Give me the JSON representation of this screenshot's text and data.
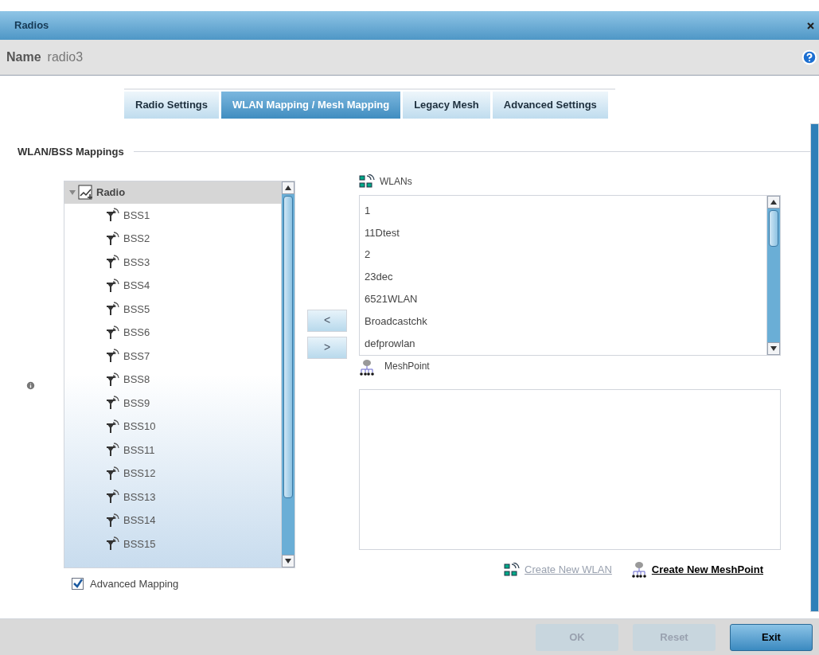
{
  "window": {
    "title": "Radios",
    "name_label": "Name",
    "name_value": "radio3"
  },
  "tabs": [
    {
      "label": "Radio Settings",
      "selected": false
    },
    {
      "label": "WLAN Mapping / Mesh Mapping",
      "selected": true
    },
    {
      "label": "Legacy Mesh",
      "selected": false
    },
    {
      "label": "Advanced Settings",
      "selected": false
    }
  ],
  "section": {
    "title": "WLAN/BSS Mappings"
  },
  "tree": {
    "label": "Radio",
    "expanded": true,
    "children": [
      {
        "label": "BSS1"
      },
      {
        "label": "BSS2"
      },
      {
        "label": "BSS3"
      },
      {
        "label": "BSS4"
      },
      {
        "label": "BSS5"
      },
      {
        "label": "BSS6"
      },
      {
        "label": "BSS7"
      },
      {
        "label": "BSS8"
      },
      {
        "label": "BSS9"
      },
      {
        "label": "BSS10"
      },
      {
        "label": "BSS11"
      },
      {
        "label": "BSS12"
      },
      {
        "label": "BSS13"
      },
      {
        "label": "BSS14"
      },
      {
        "label": "BSS15"
      }
    ]
  },
  "advanced_mapping": {
    "label": "Advanced Mapping",
    "checked": true
  },
  "move_buttons": [
    "<",
    ">"
  ],
  "wlans": {
    "title": "WLANs",
    "items": [
      "1",
      "11Dtest",
      "2",
      "23dec",
      "6521WLAN",
      "Broadcastchk",
      "defprowlan"
    ]
  },
  "meshpoint": {
    "title": "MeshPoint"
  },
  "links": [
    {
      "kind": "wlan",
      "label": "Create New WLAN",
      "disabled": true
    },
    {
      "kind": "mesh",
      "label": "Create New MeshPoint",
      "disabled": false
    }
  ],
  "footer_buttons": [
    {
      "label": "OK",
      "disabled": true
    },
    {
      "label": "Reset",
      "disabled": true
    },
    {
      "label": "Exit",
      "disabled": false
    }
  ]
}
